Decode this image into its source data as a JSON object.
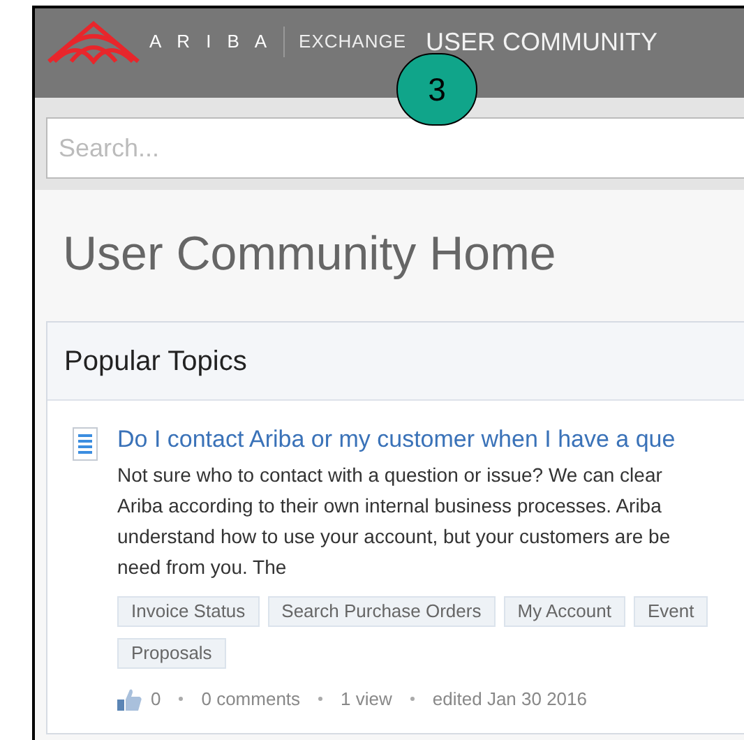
{
  "header": {
    "brand": "A R I B A",
    "product": "EXCHANGE",
    "title": "USER COMMUNITY"
  },
  "callout": {
    "label": "3"
  },
  "search": {
    "placeholder": "Search..."
  },
  "page_title": "User Community Home",
  "card": {
    "title": "Popular Topics",
    "topics": [
      {
        "title": "Do I contact Ariba or my customer when I have a que",
        "excerpt_lines": [
          "Not sure who to contact with a question or issue? We can clear",
          "Ariba according to their own internal business processes. Ariba",
          "understand how to use your account, but your customers are be",
          "need from you. The"
        ],
        "tags": [
          [
            "Invoice Status",
            "Search Purchase Orders",
            "My Account",
            "Event"
          ],
          [
            "Proposals"
          ]
        ],
        "likes": "0",
        "comments": "0 comments",
        "views": "1 view",
        "edited": "edited Jan 30 2016"
      }
    ]
  }
}
